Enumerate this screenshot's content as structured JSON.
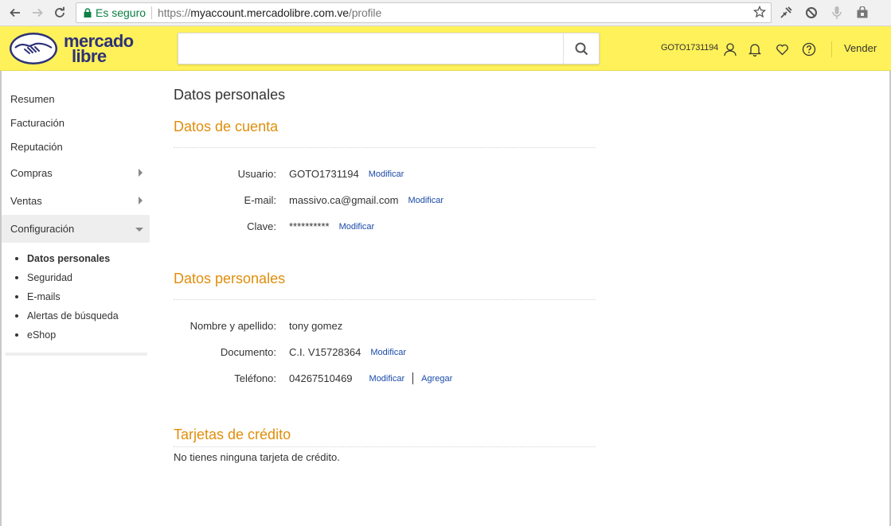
{
  "browser": {
    "secure_label": "Es seguro",
    "url_scheme": "https://",
    "url_domain": "myaccount.mercadolibre.com.ve",
    "url_path": "/profile"
  },
  "header": {
    "logo_line1": "mercado",
    "logo_line2": "libre",
    "search_placeholder": "",
    "username": "GOTO1731194",
    "sell_label": "Vender",
    "brand_yellow": "#fff159",
    "brand_blue": "#2d3277"
  },
  "sidebar": {
    "items": [
      {
        "label": "Resumen"
      },
      {
        "label": "Facturación"
      },
      {
        "label": "Reputación"
      },
      {
        "label": "Compras"
      },
      {
        "label": "Ventas"
      },
      {
        "label": "Configuración"
      }
    ],
    "sub_items": [
      {
        "label": "Datos personales"
      },
      {
        "label": "Seguridad"
      },
      {
        "label": "E-mails"
      },
      {
        "label": "Alertas de búsqueda"
      },
      {
        "label": "eShop"
      }
    ]
  },
  "main": {
    "page_title": "Datos personales",
    "account": {
      "title": "Datos de cuenta",
      "user_label": "Usuario:",
      "user_value": "GOTO1731194",
      "email_label": "E-mail:",
      "email_value": "massivo.ca@gmail.com",
      "password_label": "Clave:",
      "password_value": "**********"
    },
    "personal": {
      "title": "Datos personales",
      "name_label": "Nombre y apellido:",
      "name_value": "tony gomez",
      "doc_label": "Documento:",
      "doc_value": "C.I. V15728364",
      "phone_label": "Teléfono:",
      "phone_value": "04267510469",
      "add_label": "Agregar"
    },
    "cards": {
      "title": "Tarjetas de crédito",
      "empty_text": "No tienes ninguna tarjeta de crédito."
    },
    "modify_label": "Modificar",
    "accent_color": "#e08e0b",
    "link_color": "#1a4aa8"
  }
}
